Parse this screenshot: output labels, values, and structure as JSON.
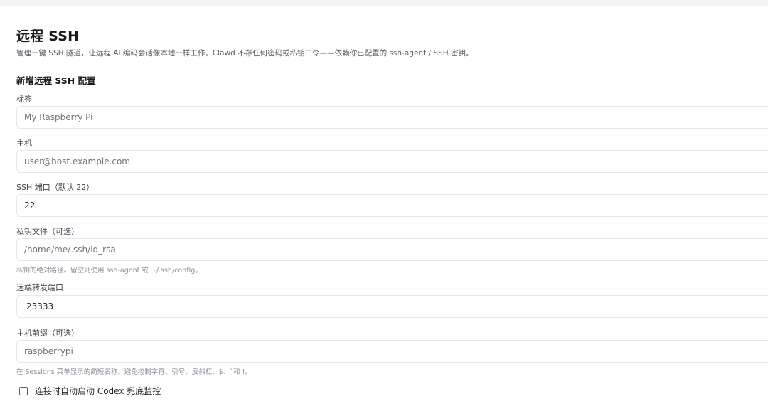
{
  "page": {
    "title": "远程 SSH",
    "description": "管理一键 SSH 隧道，让远程 AI 编码会话像本地一样工作。Clawd 不存任何密码或私钥口令——依赖你已配置的 ssh-agent / SSH 密钥。"
  },
  "form": {
    "section_title": "新增远程 SSH 配置",
    "label_field": {
      "label": "标签",
      "placeholder": "My Raspberry Pi",
      "value": ""
    },
    "host_field": {
      "label": "主机",
      "placeholder": "user@host.example.com",
      "value": ""
    },
    "port_field": {
      "label": "SSH 端口（默认 22）",
      "placeholder": "",
      "value": "22"
    },
    "key_file_field": {
      "label": "私钥文件（可选）",
      "placeholder": "/home/me/.ssh/id_rsa",
      "value": "",
      "hint": "私钥的绝对路径。留空则使用 ssh-agent 或 ~/.ssh/config。"
    },
    "remote_port_field": {
      "label": "远端转发端口",
      "placeholder": "",
      "value": "23333"
    },
    "host_prefix_field": {
      "label": "主机前缀（可选）",
      "placeholder": "raspberrypi",
      "value": "",
      "hint": "在 Sessions 菜单显示的简短名称。避免控制字符、引号、反斜杠、$、`和 !。"
    },
    "auto_codex_checkbox": {
      "label": "连接时自动启动 Codex 兜底监控",
      "checked": false
    }
  }
}
